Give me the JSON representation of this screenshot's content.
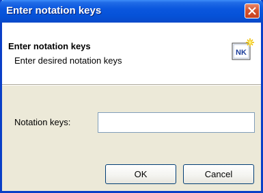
{
  "window": {
    "title": "Enter notation keys",
    "close_label": "Close"
  },
  "header": {
    "title": "Enter notation keys",
    "subtitle": "Enter desired notation keys",
    "icon_text": "NK",
    "icon": "notation-keys-wizard-icon"
  },
  "form": {
    "notation_keys_label": "Notation keys:",
    "notation_keys_value": "",
    "notation_keys_placeholder": ""
  },
  "buttons": {
    "ok_label": "OK",
    "cancel_label": "Cancel"
  },
  "colors": {
    "titlebar": "#0a56de",
    "frame": "#0a3fc7",
    "dialog_bg": "#ece9d8",
    "close_button": "#d4532e"
  }
}
